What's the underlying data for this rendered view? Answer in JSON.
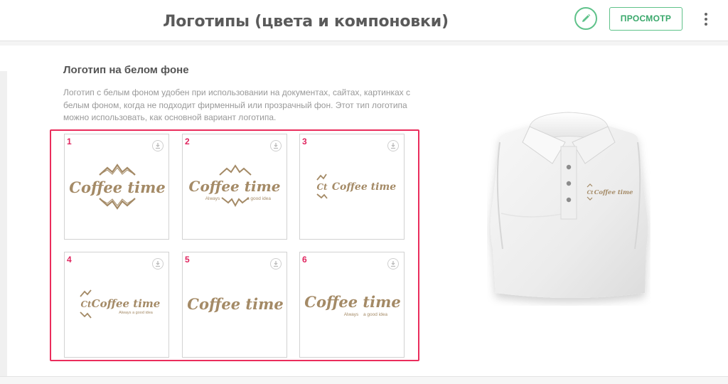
{
  "header": {
    "title": "Логотипы (цвета и компоновки)",
    "preview_label": "ПРОСМОТР",
    "accent_color": "#5fc28a"
  },
  "section": {
    "title": "Логотип на белом фоне",
    "description": "Логотип с белым фоном удобен при использовании на документах, сайтах, картинках с белым фоном, когда не подходит фирменный или прозрачный фон. Этот тип логотипа можно использовать, как основной вариант логотипа."
  },
  "logo": {
    "brand": "Coffee time",
    "monogram": "Ct",
    "slogan_left": "Always",
    "slogan_right": "a good idea",
    "slogan_full": "Always a good idea",
    "color": "#a48a66"
  },
  "variants": [
    {
      "number": "1"
    },
    {
      "number": "2"
    },
    {
      "number": "3"
    },
    {
      "number": "4"
    },
    {
      "number": "5"
    },
    {
      "number": "6"
    }
  ],
  "selection_color": "#ea2d5c",
  "icons": {
    "edit": "pencil-icon",
    "more": "more-vertical-icon",
    "download": "download-icon"
  }
}
